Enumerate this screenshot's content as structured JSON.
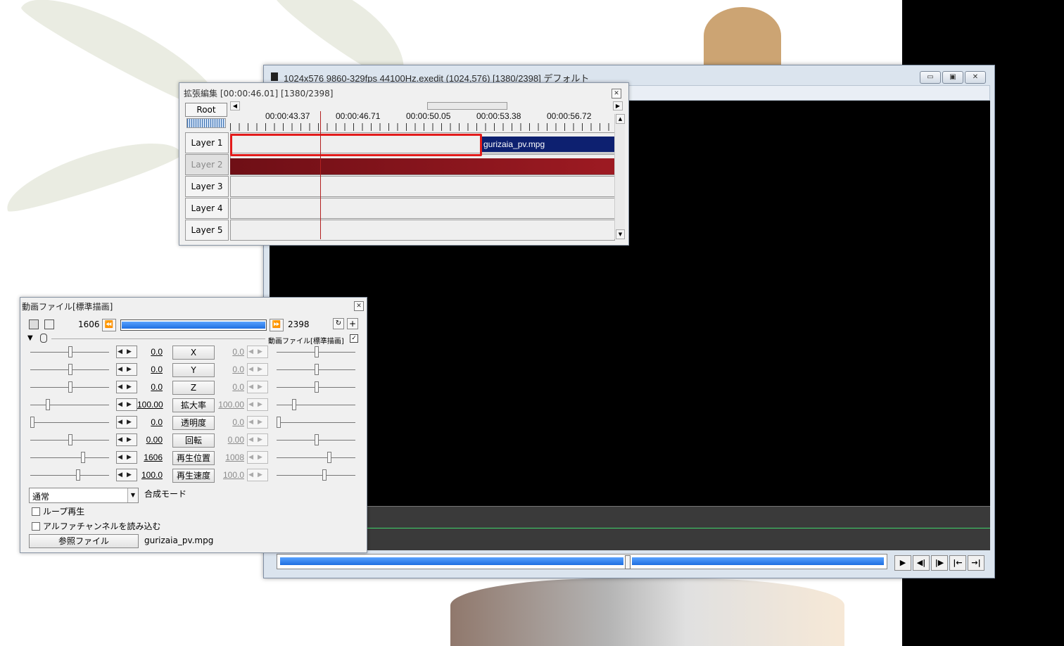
{
  "main_window": {
    "title": "1024x576  9860-329fps  44100Hz.exedit (1024,576)  [1380/2398]  デフォルト",
    "buttons": [
      "▭",
      "▣",
      "✕"
    ]
  },
  "timeline": {
    "title": "拡張編集 [00:00:46.01] [1380/2398]",
    "root_label": "Root",
    "ticks": [
      "00:00:43.37",
      "00:00:46.71",
      "00:00:50.05",
      "00:00:53.38",
      "00:00:56.72"
    ],
    "layers": [
      "Layer 1",
      "Layer 2",
      "Layer 3",
      "Layer 4",
      "Layer 5"
    ],
    "clip_name": "gurizaia_pv.mpg"
  },
  "object_panel": {
    "title": "動画ファイル[標準描画]",
    "start_frame": "1606",
    "end_frame": "2398",
    "filter_label": "動画ファイル[標準描画]",
    "params": [
      {
        "name": "X",
        "value": "0.0",
        "end": "0.0",
        "level": 0.5
      },
      {
        "name": "Y",
        "value": "0.0",
        "end": "0.0",
        "level": 0.5
      },
      {
        "name": "Z",
        "value": "0.0",
        "end": "0.0",
        "level": 0.5
      },
      {
        "name": "拡大率",
        "value": "100.00",
        "end": "100.00",
        "level": 0.2
      },
      {
        "name": "透明度",
        "value": "0.0",
        "end": "0.0",
        "level": 0.0
      },
      {
        "name": "回転",
        "value": "0.00",
        "end": "0.00",
        "level": 0.5
      },
      {
        "name": "再生位置",
        "value": "1606",
        "end": "1008",
        "level": 0.67
      },
      {
        "name": "再生速度",
        "value": "100.0",
        "end": "100.0",
        "level": 0.6
      }
    ],
    "blend_mode": "通常",
    "blend_label": "合成モード",
    "loop_label": "ループ再生",
    "alpha_label": "アルファチャンネルを読み込む",
    "ref_button": "参照ファイル",
    "ref_file": "gurizaia_pv.mpg"
  }
}
